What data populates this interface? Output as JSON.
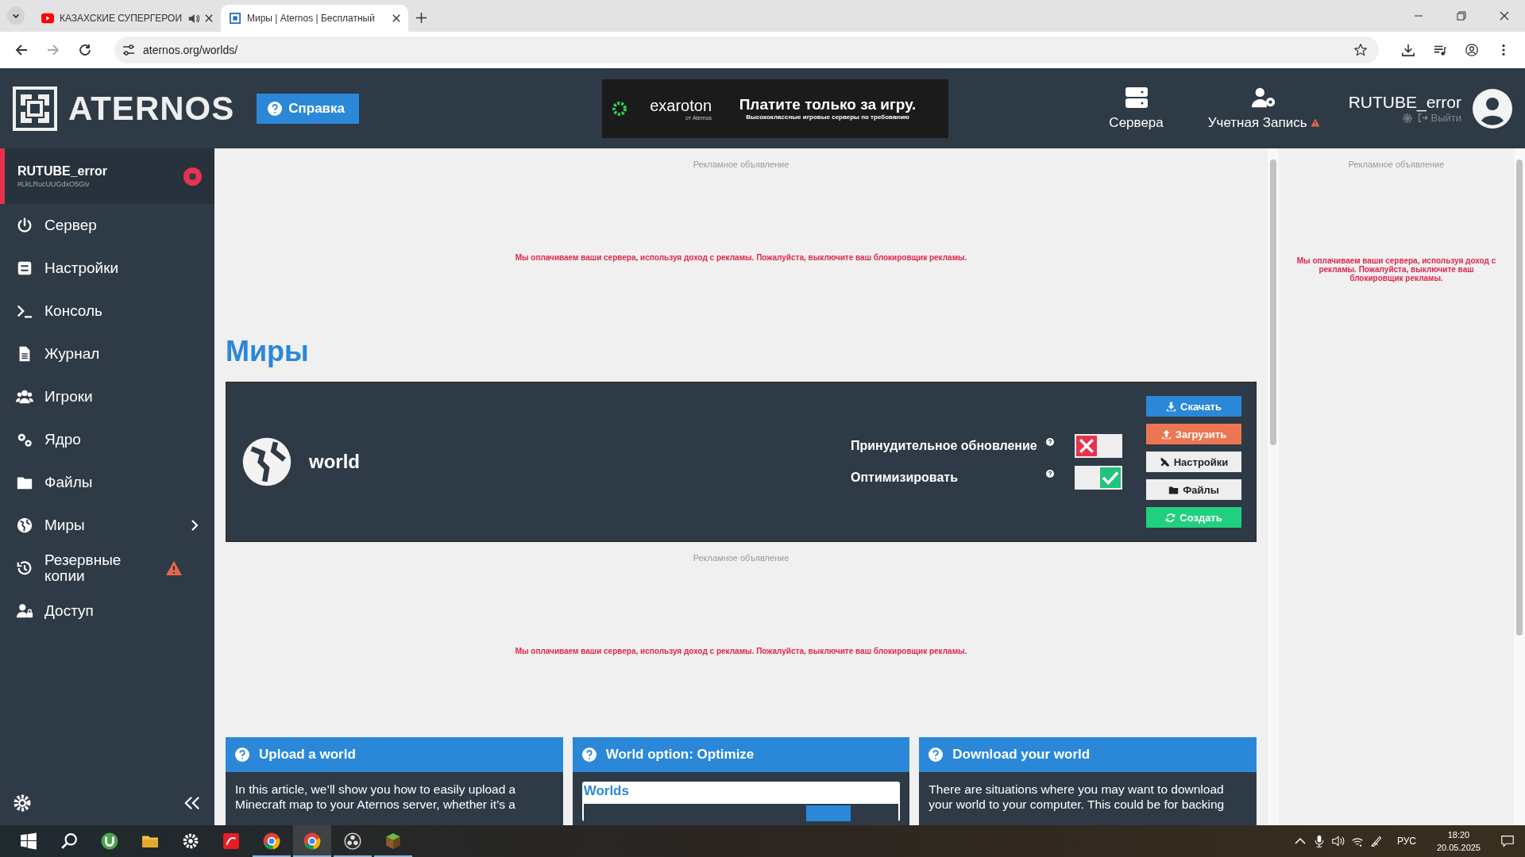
{
  "browser": {
    "tabs": [
      {
        "title": "КАЗАХСКИЕ СУПЕРГЕРОИ",
        "selected": false,
        "audio": true
      },
      {
        "title": "Миры | Aternos | Бесплатный",
        "selected": true,
        "audio": false
      }
    ],
    "url": "aternos.org/worlds/"
  },
  "header": {
    "logo": "ATERNOS",
    "help_button": "Справка",
    "banner": {
      "brand": "exaroton",
      "brand_sub": "от Aternos",
      "headline": "Платите только за игру.",
      "subline": "Высококлассные игровые серверы по требованию"
    },
    "nav": [
      {
        "label": "Сервера",
        "warning": false
      },
      {
        "label": "Учетная Запись",
        "warning": true
      }
    ],
    "user": {
      "name": "RUTUBE_error",
      "logout": "Выйти"
    }
  },
  "sidebar": {
    "server": {
      "name": "RUTUBE_error",
      "id": "#LkLRucUUGdxO5Giv"
    },
    "items": [
      {
        "label": "Сервер",
        "submenu": false,
        "warning": false
      },
      {
        "label": "Настройки",
        "submenu": false,
        "warning": false
      },
      {
        "label": "Консоль",
        "submenu": false,
        "warning": false
      },
      {
        "label": "Журнал",
        "submenu": false,
        "warning": false
      },
      {
        "label": "Игроки",
        "submenu": false,
        "warning": false
      },
      {
        "label": "Ядро",
        "submenu": false,
        "warning": false
      },
      {
        "label": "Файлы",
        "submenu": false,
        "warning": false
      },
      {
        "label": "Миры",
        "submenu": true,
        "warning": false
      },
      {
        "label": "Резервные копии",
        "submenu": false,
        "warning": true
      },
      {
        "label": "Доступ",
        "submenu": false,
        "warning": false
      }
    ]
  },
  "ads": [
    {
      "label": "Рекламное объявление",
      "notice": "Мы оплачиваем ваши сервера, используя доход с рекламы. Пожалуйста, выключите ваш блокировщик рекламы."
    },
    {
      "label": "Рекламное объявление",
      "notice": "Мы оплачиваем ваши сервера, используя доход с рекламы. Пожалуйста, выключите ваш блокировщик рекламы."
    },
    {
      "label": "Рекламное объявление",
      "notice": "Мы оплачиваем ваши сервера, используя доход с рекламы. Пожалуйста, выключите ваш блокировщик рекламы."
    }
  ],
  "page_title": "Миры",
  "world": {
    "name": "world",
    "options": [
      {
        "label": "Принудительное обновление",
        "on": false
      },
      {
        "label": "Оптимизировать",
        "on": true
      }
    ],
    "buttons": [
      {
        "label": "Скачать",
        "kind": "primary"
      },
      {
        "label": "Загрузить",
        "kind": "warning"
      },
      {
        "label": "Настройки",
        "kind": "default"
      },
      {
        "label": "Файлы",
        "kind": "default"
      },
      {
        "label": "Создать",
        "kind": "success"
      }
    ]
  },
  "articles": [
    {
      "title": "Upload a world",
      "text": "In this article, we’ll show you how to easily upload a Minecraft map to your Aternos server, whether it’s a"
    },
    {
      "title": "World option: Optimize",
      "panel_title": "Worlds"
    },
    {
      "title": "Download your world",
      "text": "There are situations where you may want to download your world to your computer. This could be for backing"
    }
  ],
  "taskbar": {
    "language": "РУС",
    "time": "18:20",
    "date": "20.05.2025"
  }
}
